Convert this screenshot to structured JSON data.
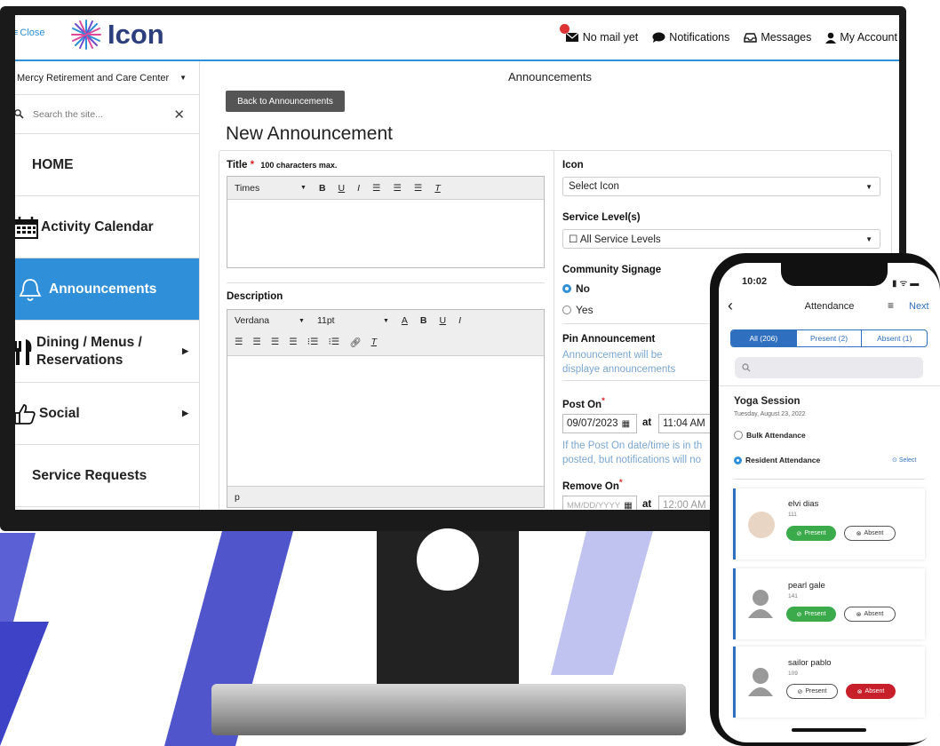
{
  "topbar": {
    "close_label": "Close",
    "logo_text": "Icon",
    "nav": [
      {
        "label": "No mail yet",
        "icon": "mail-icon"
      },
      {
        "label": "Notifications",
        "icon": "chat-bubble-icon"
      },
      {
        "label": "Messages",
        "icon": "inbox-icon"
      },
      {
        "label": "My Account",
        "icon": "user-icon"
      }
    ]
  },
  "sidebar": {
    "site_name": "Mercy Retirement and Care Center",
    "search_placeholder": "Search the site...",
    "items": [
      {
        "label": "HOME",
        "icon": ""
      },
      {
        "label": "Activity Calendar",
        "icon": "calendar-icon"
      },
      {
        "label": "Announcements",
        "icon": "bell-icon",
        "active": true
      },
      {
        "label": "Dining / Menus / Reservations",
        "icon": "utensils-icon"
      },
      {
        "label": "Social",
        "icon": "thumbs-up-icon"
      },
      {
        "label": "Service Requests",
        "icon": ""
      }
    ]
  },
  "main": {
    "breadcrumb": "Announcements",
    "back_button": "Back to Announcements",
    "page_title": "New Announcement",
    "title_label": "Title",
    "title_hint": "100 characters max.",
    "title_toolbar_font": "Times",
    "description_label": "Description",
    "desc_font": "Verdana",
    "desc_size": "11pt",
    "desc_path": "p",
    "icon_label": "Icon",
    "icon_select": "Select Icon",
    "service_label": "Service Level(s)",
    "service_select": "All Service Levels",
    "signage_label": "Community Signage",
    "signage_no": "No",
    "signage_yes": "Yes",
    "pin_label": "Pin Announcement",
    "pin_hint": "Announcement will be displaye announcements",
    "post_on_label": "Post On",
    "post_date": "09/07/2023",
    "at_label": "at",
    "post_time": "11:04 AM",
    "post_hint": "If the Post On date/time is in th posted, but notifications will no",
    "remove_on_label": "Remove On",
    "remove_date_placeholder": "MM/DD/YYYY",
    "remove_time": "12:00 AM"
  },
  "phone": {
    "time": "10:02",
    "header_title": "Attendance",
    "next_label": "Next",
    "tabs": [
      "All (206)",
      "Present (2)",
      "Absent (1)"
    ],
    "event_title": "Yoga Session",
    "event_date": "Tuesday, August 23, 2022",
    "bulk_label": "Bulk Attendance",
    "resident_label": "Resident Attendance",
    "select_label": "Select",
    "present_label": "Present",
    "absent_label": "Absent",
    "residents": [
      {
        "name": "elvi  dias",
        "id": "111",
        "status": "present"
      },
      {
        "name": "pearl  gale",
        "id": "141",
        "status": "present"
      },
      {
        "name": "sailor  pablo",
        "id": "109",
        "status": "absent"
      }
    ]
  },
  "colors": {
    "accent": "#2f8fd8",
    "present": "#3aaa4a",
    "absent": "#c8202a",
    "brand": "#2c3e7c",
    "phone_accent": "#2f6fbf"
  }
}
